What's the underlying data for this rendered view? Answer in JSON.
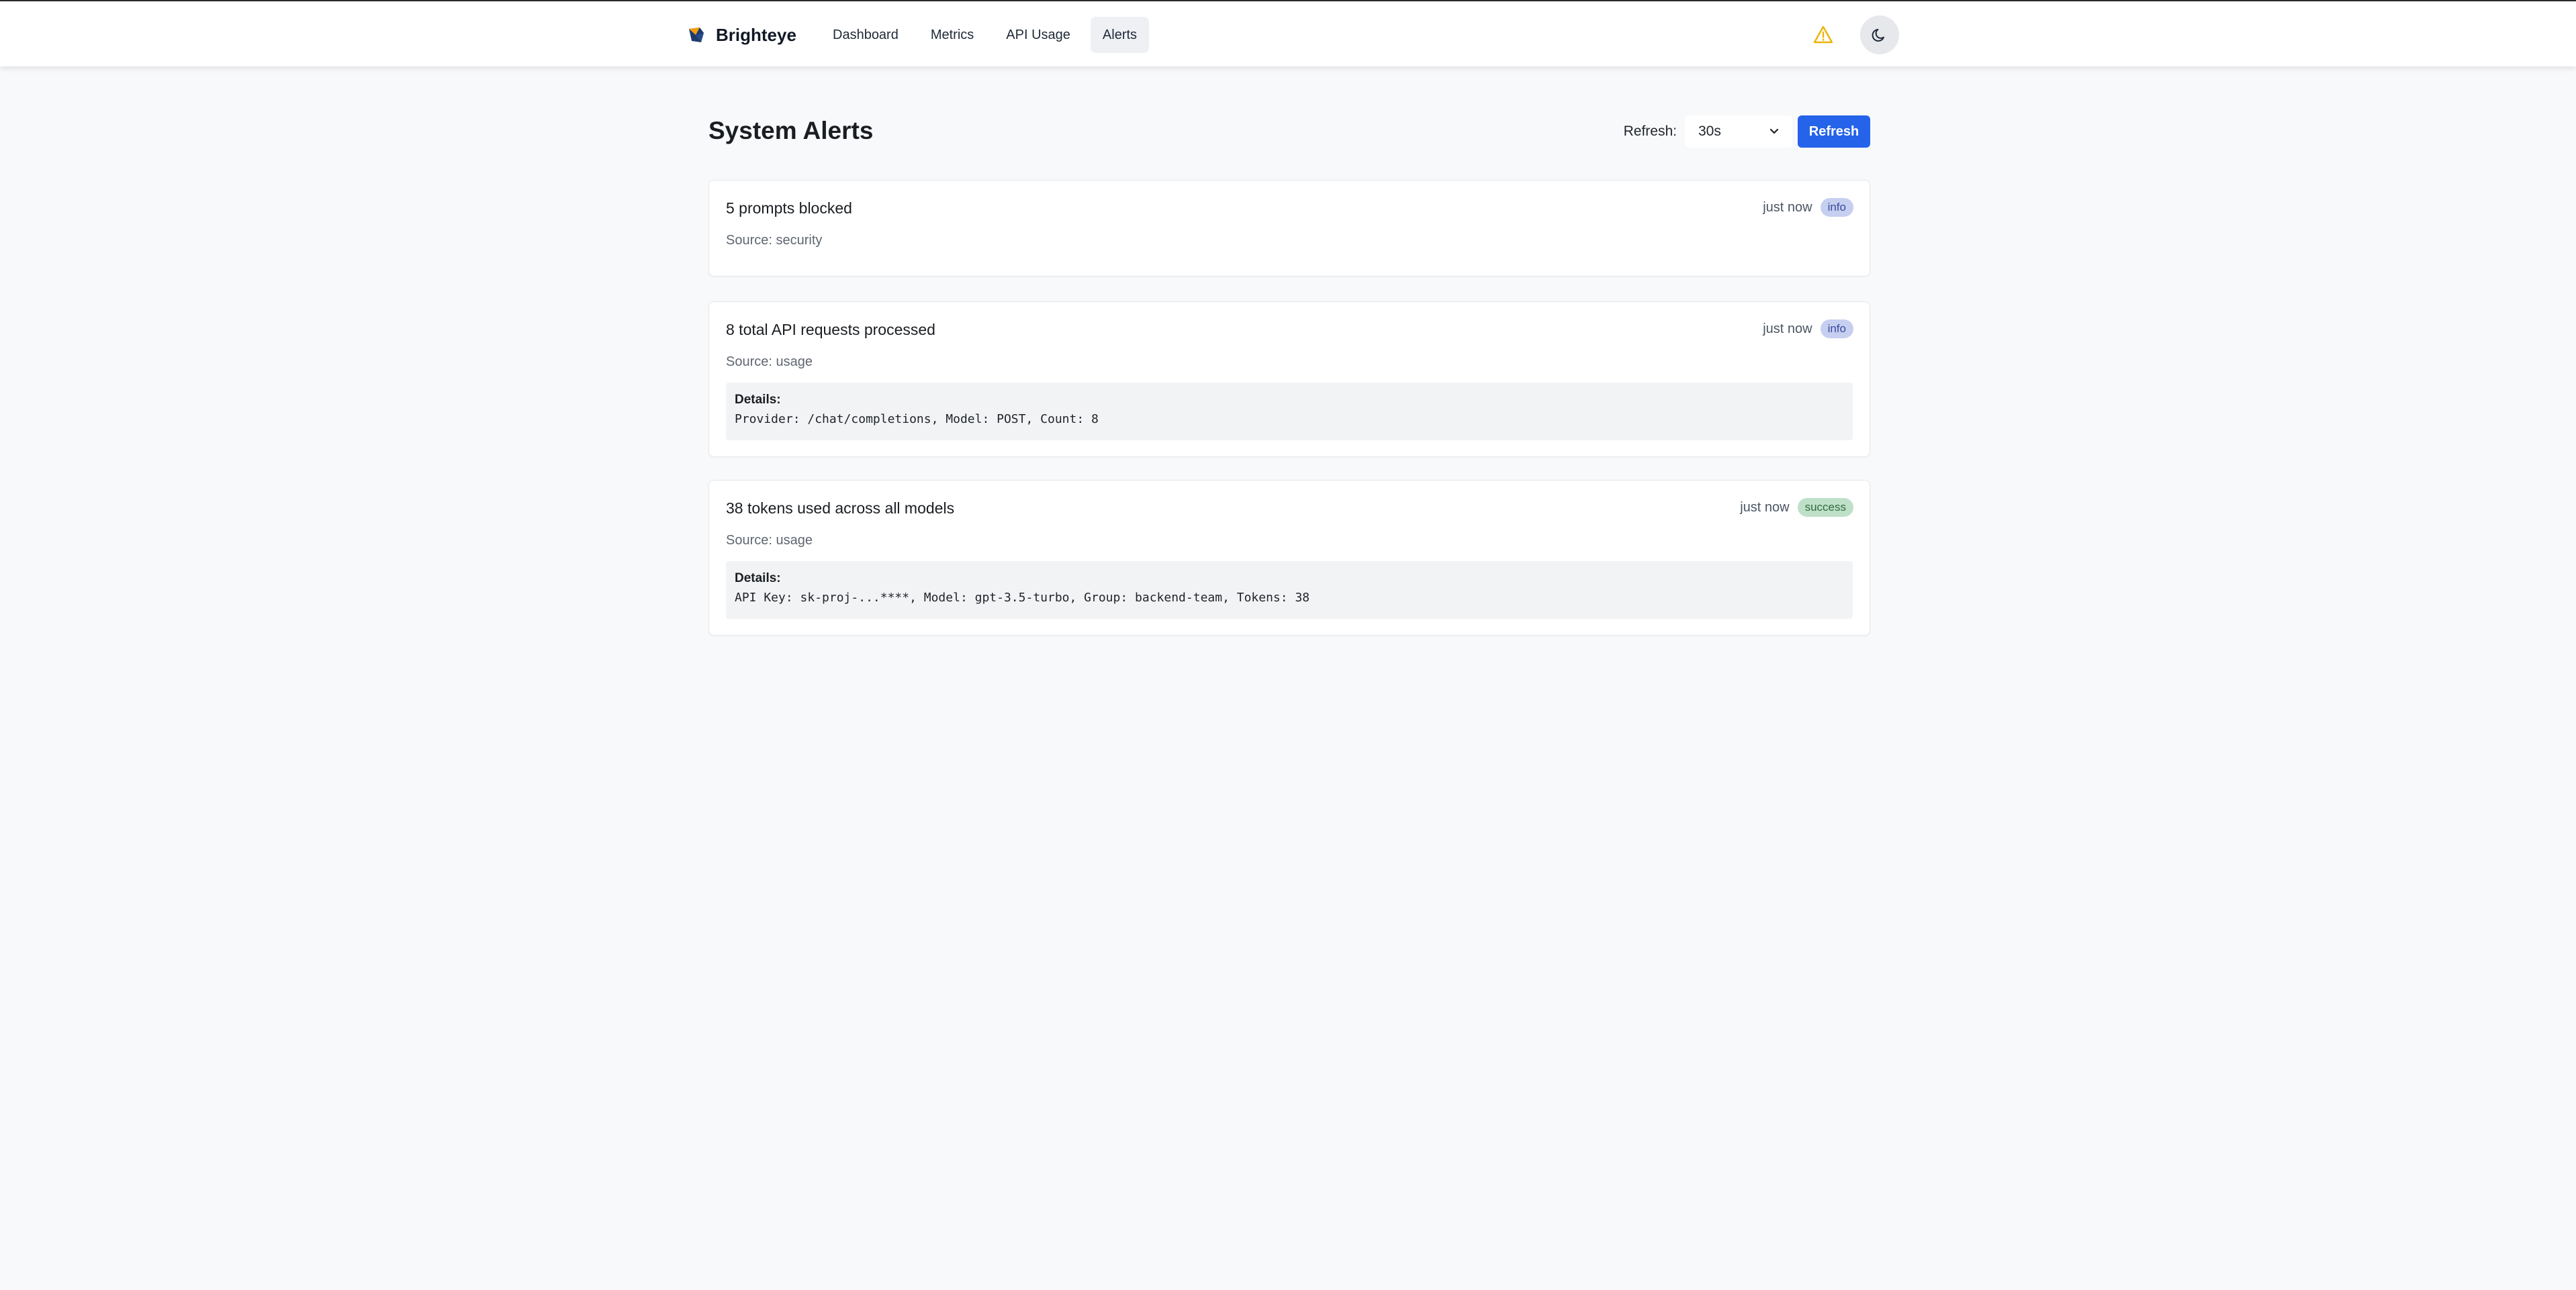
{
  "nav": {
    "brand": "Brighteye",
    "items": [
      {
        "label": "Dashboard",
        "active": false
      },
      {
        "label": "Metrics",
        "active": false
      },
      {
        "label": "API Usage",
        "active": false
      },
      {
        "label": "Alerts",
        "active": true
      }
    ],
    "icons": {
      "warning": "warning-triangle-icon",
      "theme": "moon-icon"
    },
    "warning_color": "#eab308"
  },
  "page": {
    "title": "System Alerts",
    "refresh_label": "Refresh:",
    "refresh_interval": "30s",
    "refresh_button": "Refresh",
    "accent_color": "#2563eb"
  },
  "alerts": [
    {
      "title": "5 prompts blocked",
      "time": "just now",
      "level": "info",
      "source": "Source: security"
    },
    {
      "title": "8 total API requests processed",
      "time": "just now",
      "level": "info",
      "source": "Source: usage",
      "details_label": "Details:",
      "details": "Provider: /chat/completions, Model: POST, Count: 8"
    },
    {
      "title": "38 tokens used across all models",
      "time": "just now",
      "level": "success",
      "source": "Source: usage",
      "details_label": "Details:",
      "details": "API Key: sk-proj-...****, Model: gpt-3.5-turbo, Group: backend-team, Tokens: 38"
    }
  ]
}
